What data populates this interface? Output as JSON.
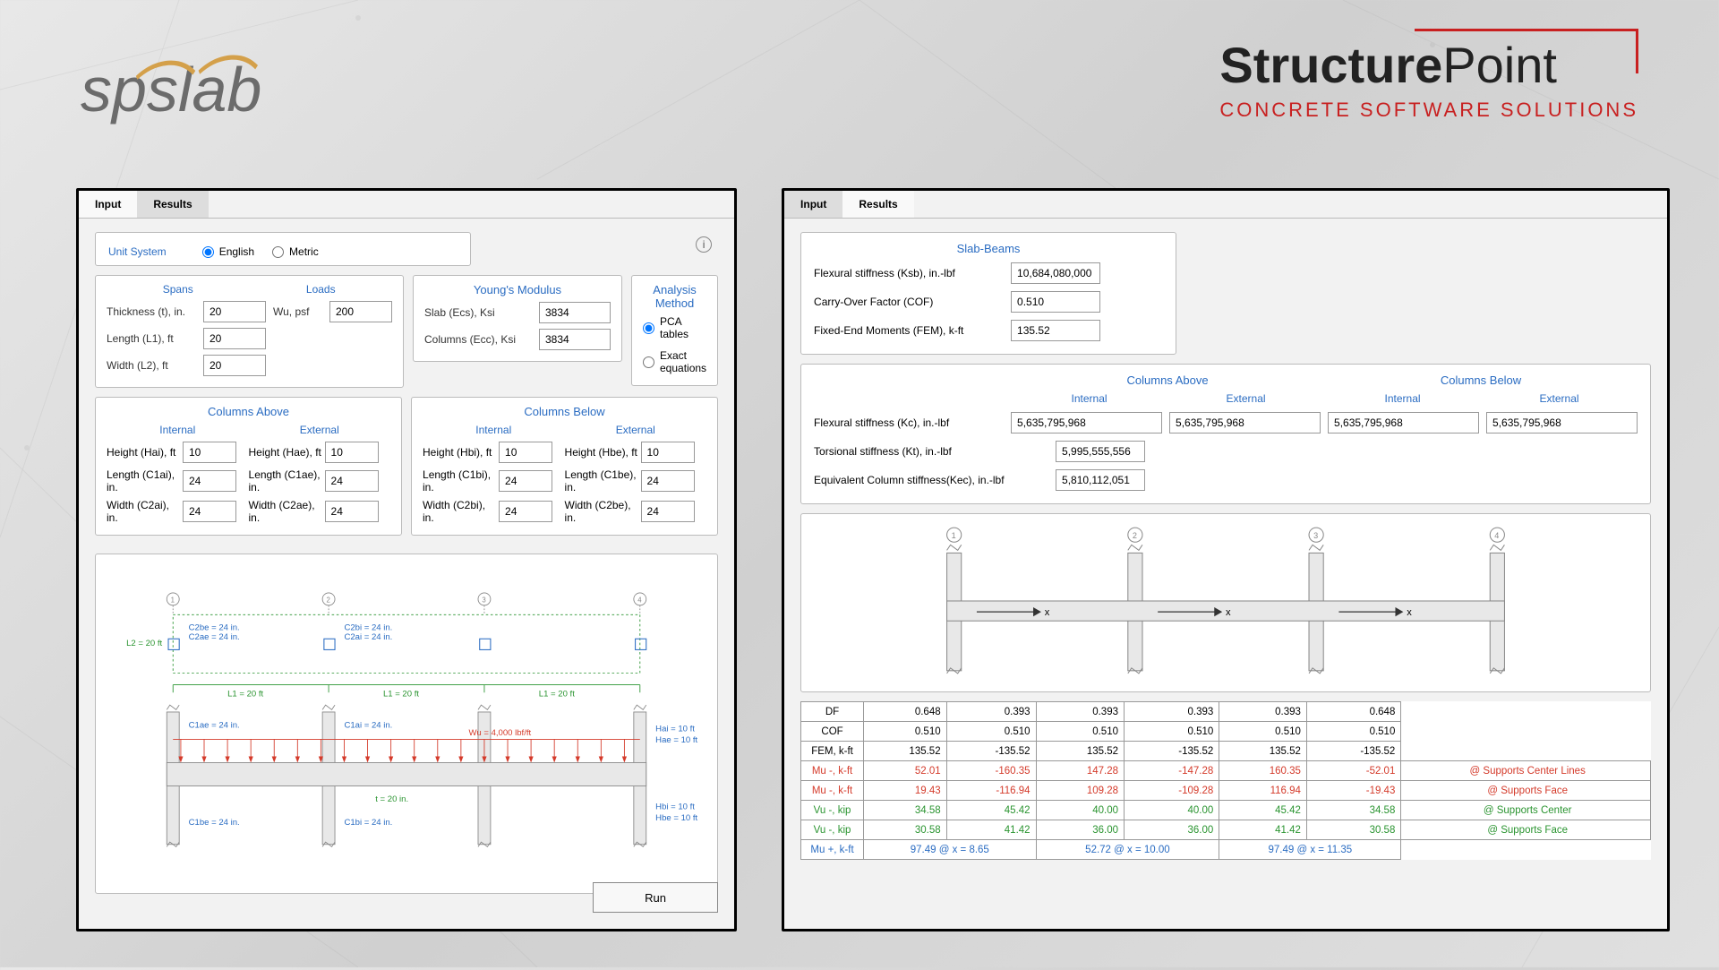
{
  "logos": {
    "left": "spslab",
    "right_title": "StructurePoint",
    "right_sub": "CONCRETE SOFTWARE SOLUTIONS"
  },
  "left_panel": {
    "tabs": [
      "Input",
      "Results"
    ],
    "active": "Input",
    "unit_system": {
      "label": "Unit System",
      "options": [
        "English",
        "Metric"
      ],
      "selected": "English"
    },
    "spans": {
      "title": "Spans",
      "thickness": {
        "label": "Thickness (t), in.",
        "value": "20"
      },
      "length_l1": {
        "label": "Length (L1), ft",
        "value": "20"
      },
      "width_l2": {
        "label": "Width (L2), ft",
        "value": "20"
      }
    },
    "loads": {
      "title": "Loads",
      "wu": {
        "label": "Wu, psf",
        "value": "200"
      }
    },
    "young": {
      "title": "Young's Modulus",
      "slab": {
        "label": "Slab (Ecs), Ksi",
        "value": "3834"
      },
      "cols": {
        "label": "Columns (Ecc), Ksi",
        "value": "3834"
      }
    },
    "analysis": {
      "title": "Analysis Method",
      "options": [
        "PCA tables",
        "Exact equations"
      ],
      "selected": "PCA tables"
    },
    "cols_above": {
      "title": "Columns Above",
      "internal": {
        "title": "Internal",
        "h": {
          "label": "Height (Hai), ft",
          "value": "10"
        },
        "l": {
          "label": "Length (C1ai), in.",
          "value": "24"
        },
        "w": {
          "label": "Width (C2ai), in.",
          "value": "24"
        }
      },
      "external": {
        "title": "External",
        "h": {
          "label": "Height (Hae), ft",
          "value": "10"
        },
        "l": {
          "label": "Length (C1ae), in.",
          "value": "24"
        },
        "w": {
          "label": "Width (C2ae), in.",
          "value": "24"
        }
      }
    },
    "cols_below": {
      "title": "Columns Below",
      "internal": {
        "title": "Internal",
        "h": {
          "label": "Height (Hbi), ft",
          "value": "10"
        },
        "l": {
          "label": "Length (C1bi), in.",
          "value": "24"
        },
        "w": {
          "label": "Width (C2bi), in.",
          "value": "24"
        }
      },
      "external": {
        "title": "External",
        "h": {
          "label": "Height (Hbe), ft",
          "value": "10"
        },
        "l": {
          "label": "Length (C1be), in.",
          "value": "24"
        },
        "w": {
          "label": "Width (C2be), in.",
          "value": "24"
        }
      }
    },
    "diagram_labels": {
      "L2": "L2 = 20 ft",
      "L1": "L1 = 20 ft",
      "C2be": "C2be = 24 in.",
      "C2ae": "C2ae = 24 in.",
      "C2bi": "C2bi = 24 in.",
      "C2ai": "C2ai = 24 in.",
      "C1ae": "C1ae = 24 in.",
      "C1ai": "C1ai = 24 in.",
      "C1be": "C1be = 24 in.",
      "C1bi": "C1bi = 24 in.",
      "Wu": "Wu = 4,000 lbf/ft",
      "t": "t = 20 in.",
      "Hai": "Hai = 10 ft",
      "Hae": "Hae = 10 ft",
      "Hbi": "Hbi = 10 ft",
      "Hbe": "Hbe = 10 ft"
    },
    "run": "Run"
  },
  "right_panel": {
    "tabs": [
      "Input",
      "Results"
    ],
    "active": "Results",
    "slab_beams": {
      "title": "Slab-Beams",
      "ksb": {
        "label": "Flexural stiffness (Ksb), in.-lbf",
        "value": "10,684,080,000"
      },
      "cof": {
        "label": "Carry-Over Factor (COF)",
        "value": "0.510"
      },
      "fem": {
        "label": "Fixed-End Moments (FEM), k-ft",
        "value": "135.52"
      }
    },
    "col_results": {
      "cols_above": "Columns Above",
      "cols_below": "Columns Below",
      "internal": "Internal",
      "external": "External",
      "kc": {
        "label": "Flexural stiffness (Kc), in.-lbf",
        "values": [
          "5,635,795,968",
          "5,635,795,968",
          "5,635,795,968",
          "5,635,795,968"
        ]
      },
      "kt": {
        "label": "Torsional stiffness (Kt), in.-lbf",
        "value": "5,995,555,556"
      },
      "kec": {
        "label": "Equivalent Column stiffness(Kec), in.-lbf",
        "value": "5,810,112,051"
      }
    },
    "table": {
      "rows": [
        {
          "label": "DF",
          "cells": [
            "0.648",
            "0.393",
            "0.393",
            "0.393",
            "0.393",
            "0.648"
          ],
          "cls": ""
        },
        {
          "label": "COF",
          "cells": [
            "0.510",
            "0.510",
            "0.510",
            "0.510",
            "0.510",
            "0.510"
          ],
          "cls": ""
        },
        {
          "label": "FEM, k-ft",
          "cells": [
            "135.52",
            "-135.52",
            "135.52",
            "-135.52",
            "135.52",
            "-135.52"
          ],
          "cls": ""
        },
        {
          "label": "Mu -, k-ft",
          "cells": [
            "52.01",
            "-160.35",
            "147.28",
            "-147.28",
            "160.35",
            "-52.01"
          ],
          "note": "@ Supports Center Lines",
          "cls": "red"
        },
        {
          "label": "Mu -, k-ft",
          "cells": [
            "19.43",
            "-116.94",
            "109.28",
            "-109.28",
            "116.94",
            "-19.43"
          ],
          "note": "@ Supports Face",
          "cls": "red"
        },
        {
          "label": "Vu -, kip",
          "cells": [
            "34.58",
            "45.42",
            "40.00",
            "40.00",
            "45.42",
            "34.58"
          ],
          "note": "@ Supports Center",
          "cls": "green"
        },
        {
          "label": "Vu -, kip",
          "cells": [
            "30.58",
            "41.42",
            "36.00",
            "36.00",
            "41.42",
            "30.58"
          ],
          "note": "@ Supports Face",
          "cls": "green"
        }
      ],
      "muplus": {
        "label": "Mu +, k-ft",
        "spans": [
          "97.49 @ x = 8.65",
          "52.72 @ x = 10.00",
          "97.49 @ x = 11.35"
        ],
        "cls": "blue"
      }
    }
  }
}
